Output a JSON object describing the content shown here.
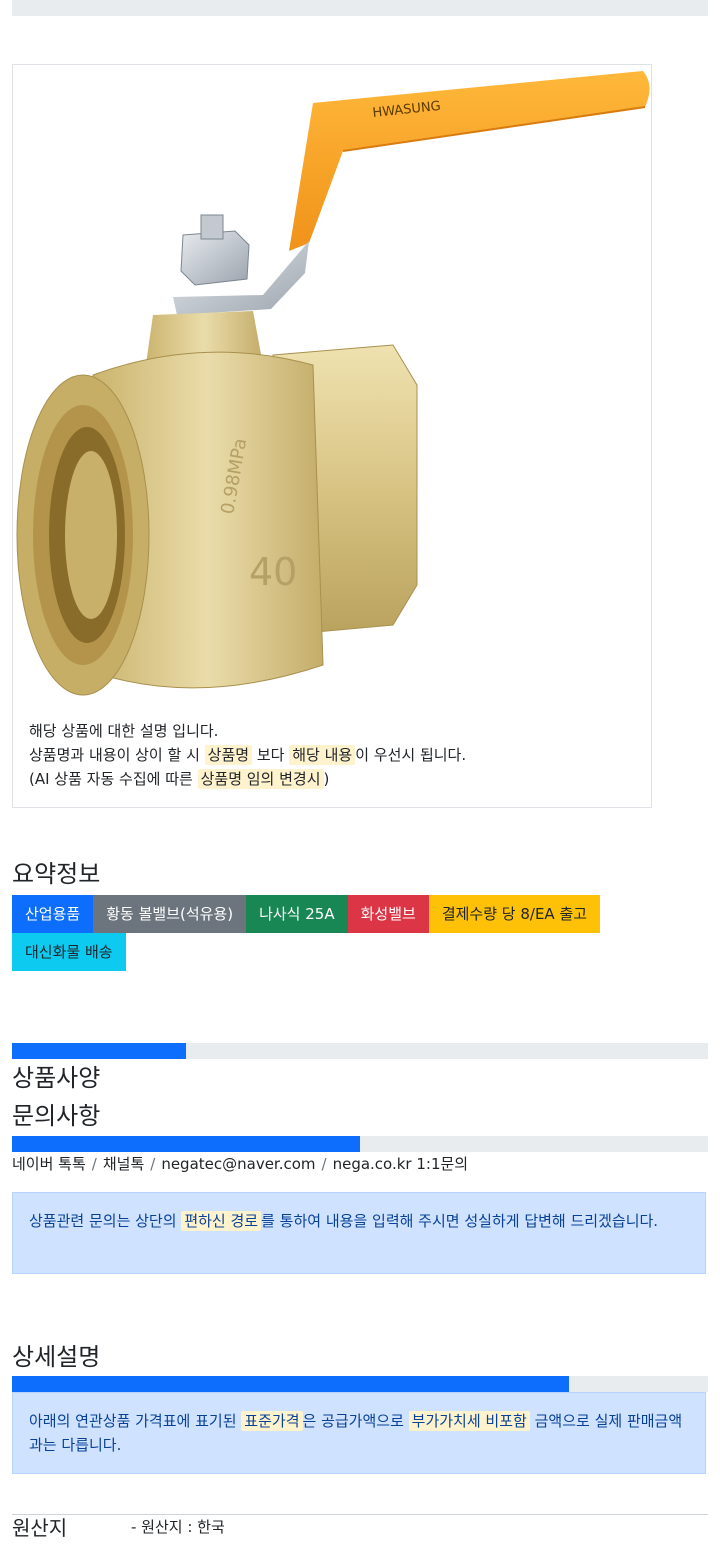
{
  "product_card": {
    "image_alt": "화성밸브 황동 볼밸브",
    "valve_markings": {
      "brand": "HWASUNG",
      "pressure": "0.98MPa",
      "size": "40"
    },
    "desc_line1": "해당 상품에 대한 설명 입니다.",
    "desc_line2_a": "상품명과 내용이 상이 할 시",
    "desc_line2_hl1": "상품명",
    "desc_line2_b": "보다",
    "desc_line2_hl2": "해당 내용",
    "desc_line2_c": "이 우선시 됩니다.",
    "desc_line3_a": "(AI 상품 자동 수집에 따른",
    "desc_line3_hl": "상품명 임의 변경시",
    "desc_line3_b": ")"
  },
  "summary": {
    "title": "요약정보",
    "badges": [
      "산업용품",
      "황동 볼밸브(석유용)",
      "나사식 25A",
      "화성밸브",
      "결제수량 당 8/EA 출고",
      "대신화물 배송"
    ]
  },
  "spec": {
    "title": "상품사양",
    "progress": 0.25
  },
  "inquiry": {
    "title": "문의사항",
    "progress": 0.5,
    "contacts": [
      "네이버 톡톡",
      "채널톡",
      "negatec@naver.com",
      "nega.co.kr 1:1문의"
    ],
    "alert_a": "상품관련 문의는 상단의",
    "alert_hl": "편하신 경로",
    "alert_b": "를 통하여 내용을 입력해 주시면 성실하게 답변해 드리겠습니다."
  },
  "detail": {
    "title": "상세설명",
    "progress": 0.8,
    "alert_a": "아래의 연관상품 가격표에 표기된",
    "alert_hl1": "표준가격",
    "alert_b": "은 공급가액으로",
    "alert_hl2": "부가가치세 비포함",
    "alert_c": "금액으로 실제 판매금액과는 다릅니다."
  },
  "origin": {
    "label": "원산지",
    "value": "- 원산지 : 한국"
  },
  "colors": {
    "primary": "#0d6efd",
    "secondary": "#6c757d",
    "success": "#198754",
    "danger": "#dc3545",
    "warning": "#ffc107",
    "info": "#0dcaf0",
    "highlight": "#fff3cd",
    "valve_handle": "#f7a21b",
    "brass": "#d9c98a"
  }
}
